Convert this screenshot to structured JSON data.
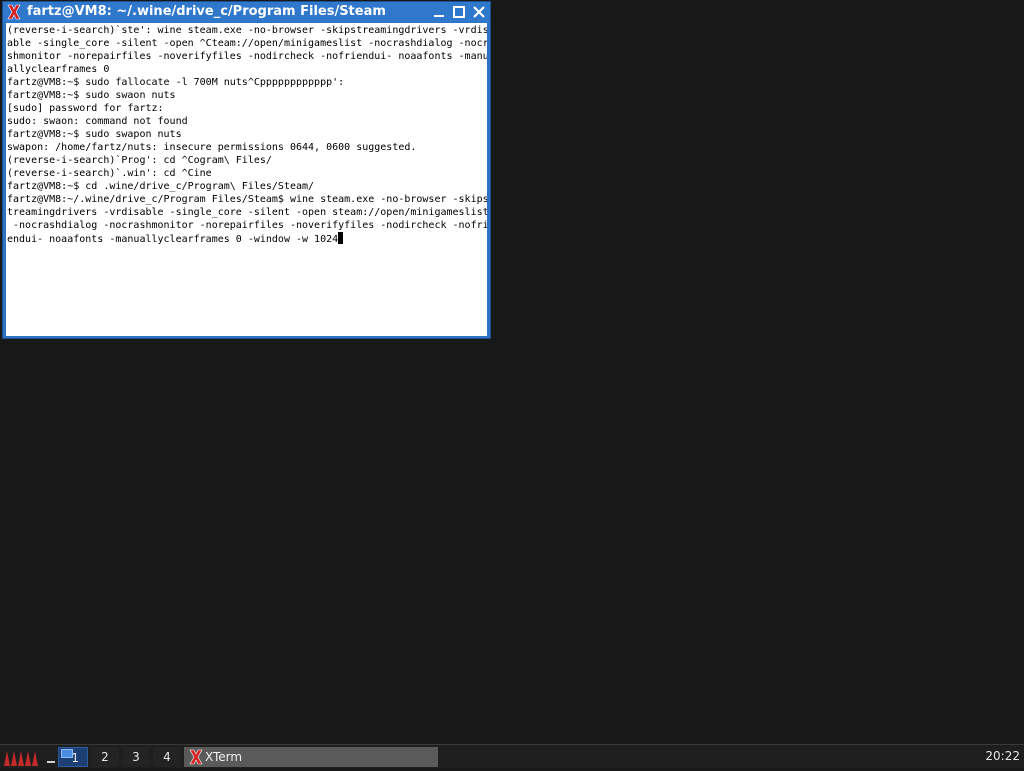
{
  "window": {
    "title": "fartz@VM8: ~/.wine/drive_c/Program Files/Steam",
    "icon": "xterm-x-icon",
    "buttons": [
      "minimize-icon",
      "maximize-icon",
      "close-icon"
    ]
  },
  "terminal": {
    "lines": [
      "(reverse-i-search)`ste': wine steam.exe -no-browser -skipstreamingdrivers -vrdis",
      "able -single_core -silent -open ^Cteam://open/minigameslist -nocrashdialog -nocra",
      "shmonitor -norepairfiles -noverifyfiles -nodircheck -nofriendui- noaafonts -manu",
      "allyclearframes 0",
      "fartz@VM8:~$ sudo fallocate -l 700M nuts^Cpppppppppppp':",
      "fartz@VM8:~$ sudo swaon nuts",
      "[sudo] password for fartz:",
      "sudo: swaon: command not found",
      "fartz@VM8:~$ sudo swapon nuts",
      "swapon: /home/fartz/nuts: insecure permissions 0644, 0600 suggested.",
      "(reverse-i-search)`Prog': cd ^Cogram\\ Files/",
      "(reverse-i-search)`.win': cd ^Cine",
      "fartz@VM8:~$ cd .wine/drive_c/Program\\ Files/Steam/",
      "fartz@VM8:~/.wine/drive_c/Program Files/Steam$ wine steam.exe -no-browser -skips",
      "treamingdrivers -vrdisable -single_core -silent -open steam://open/minigameslist",
      " -nocrashdialog -nocrashmonitor -norepairfiles -noverifyfiles -nodircheck -nofri",
      "endui- noaafonts -manuallyclearframes 0 -window -w 1024"
    ],
    "background": "#ffffff",
    "foreground": "#000000"
  },
  "taskbar": {
    "start_icon": "menu-logo-icon",
    "workspaces": [
      "1",
      "2",
      "3",
      "4"
    ],
    "active_workspace": "1",
    "task_label": "XTerm",
    "clock": "20:22"
  },
  "colors": {
    "titlebar": "#2f78cc",
    "desktop": "#181818",
    "taskbar": "#1e1e1e",
    "active_task": "#5a5a5a"
  }
}
